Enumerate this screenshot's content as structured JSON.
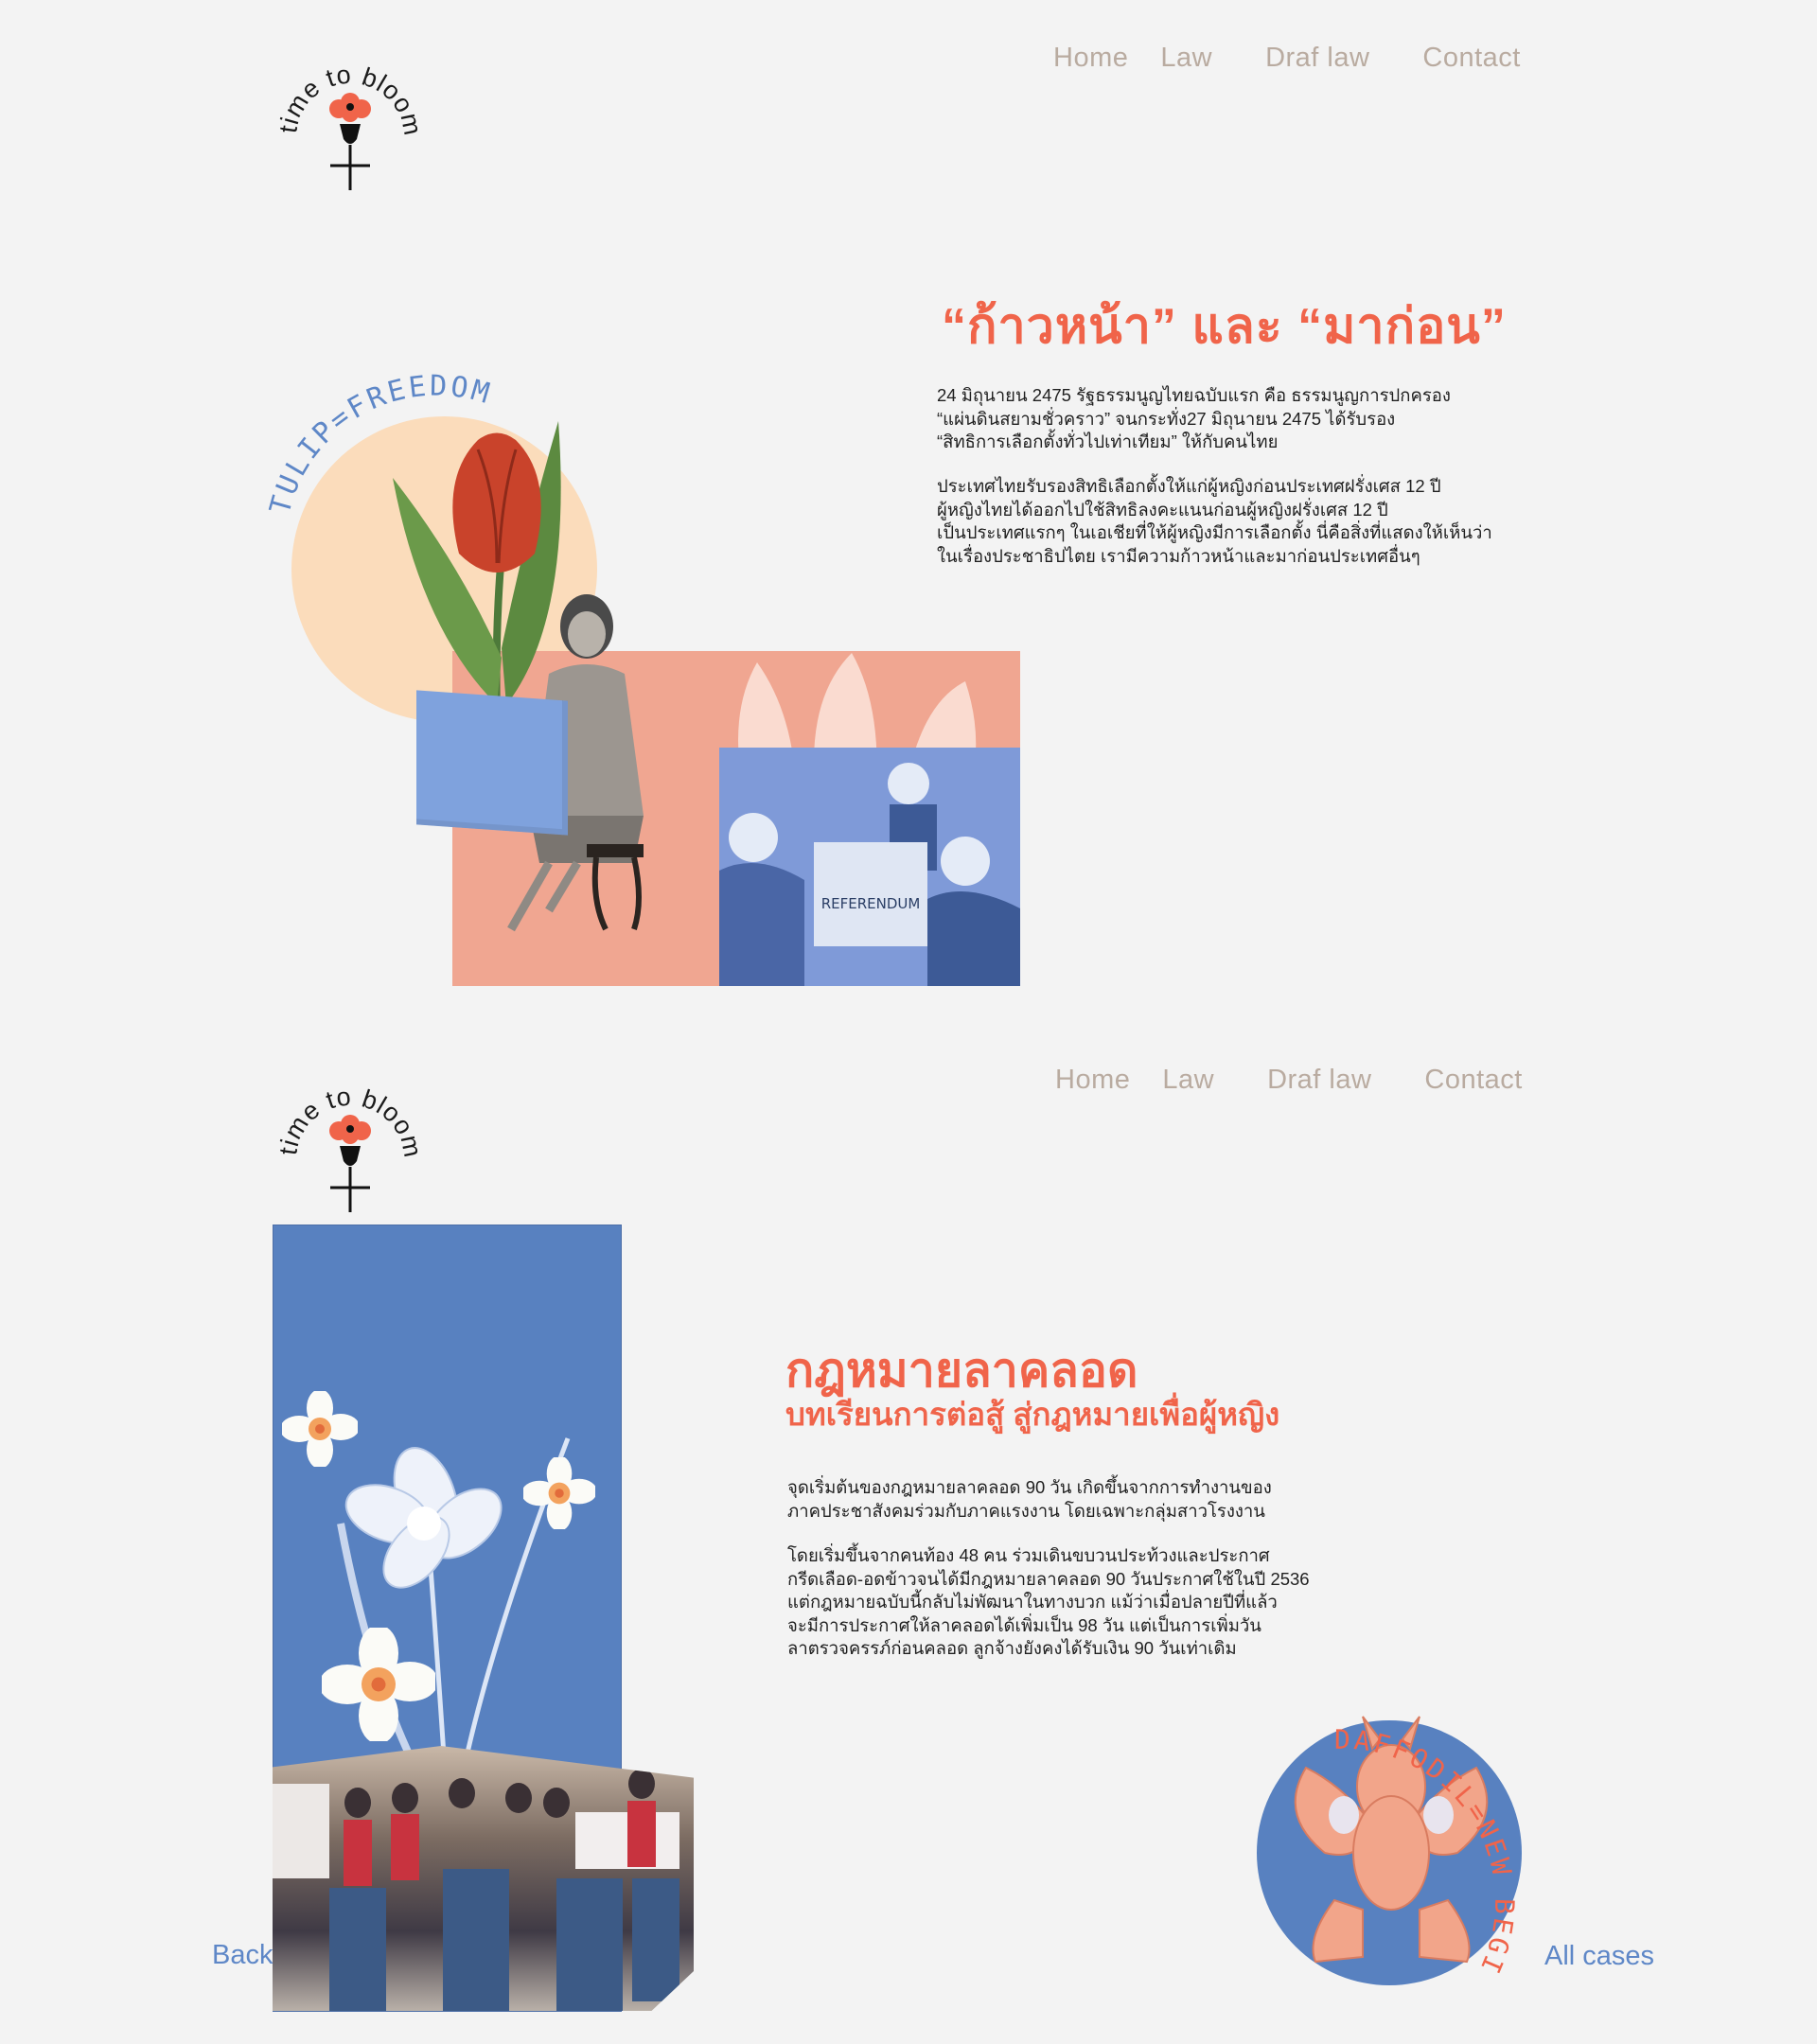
{
  "brand": {
    "logo_text": "time to bloom"
  },
  "nav": {
    "items": [
      "Home",
      "Law",
      "Draf law",
      "Contact"
    ]
  },
  "section1": {
    "title": "“ก้าวหน้า” และ “มาก่อน”",
    "para1": "24 มิถุนายน 2475 รัฐธรรมนูญไทยฉบับแรก คือ ธรรมนูญการปกครอง\n“แผ่นดินสยามชั่วคราว” จนกระทั่ง27 มิถุนายน 2475 ได้รับรอง\n“สิทธิการเลือกตั้งทั่วไปเท่าเทียม” ให้กับคนไทย",
    "para2": "ประเทศไทยรับรองสิทธิเลือกตั้งให้แก่ผู้หญิงก่อนประเทศฝรั่งเศส 12 ปี\nผู้หญิงไทยได้ออกไปใช้สิทธิลงคะแนนก่อนผู้หญิงฝรั่งเศส 12 ปี\nเป็นประเทศแรกๆ ในเอเชียที่ให้ผู้หญิงมีการเลือกตั้ง นี่คือสิ่งที่แสดงให้เห็นว่า\nในเรื่องประชาธิปไตย เรามีความก้าวหน้าและมาก่อนประเทศอื่นๆ",
    "badge": "TULIP=FREEDOM",
    "ballot_label": "REFERENDUM"
  },
  "section2": {
    "title": "กฎหมายลาคลอด",
    "subtitle": "บทเรียนการต่อสู้ สู่กฎหมายเพื่อผู้หญิง",
    "para1": "    จุดเริ่มต้นของกฎหมายลาคลอด 90 วัน เกิดขึ้นจากการทำงานของ\nภาคประชาสังคมร่วมกับภาคแรงงาน โดยเฉพาะกลุ่มสาวโรงงาน",
    "para2": "    โดยเริ่มขึ้นจากคนท้อง 48 คน ร่วมเดินขบวนประท้วงและประกาศ\nกรีดเลือด-อดข้าวจนได้มีกฎหมายลาคลอด 90 วันประกาศใช้ในปี 2536\nแต่กฎหมายฉบับนี้กลับไม่พัฒนาในทางบวก แม้ว่าเมื่อปลายปีที่แล้ว\nจะมีการประกาศให้ลาคลอดได้เพิ่มเป็น 98 วัน แต่เป็นการเพิ่มวัน\nลาตรวจครรภ์ก่อนคลอด ลูกจ้างยังคงได้รับเงิน 90 วันเท่าเดิม",
    "badge": "DAFFODIL=NEW BEGINNING",
    "back_label": "Back",
    "all_cases_label": "All cases"
  },
  "colors": {
    "background": "#f3f3f3",
    "accent_orange": "#f0644a",
    "nav_grey": "#b9aba0",
    "blue": "#5881c0",
    "peach": "#fbdcbb",
    "salmon": "#f0a691"
  }
}
